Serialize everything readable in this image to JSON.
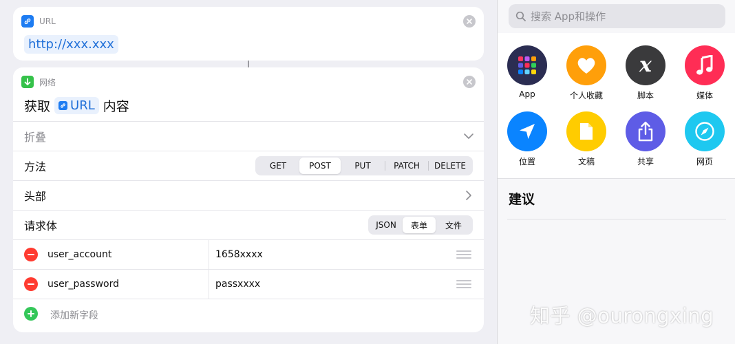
{
  "url_card": {
    "tag": "URL",
    "value": "http://xxx.xxx"
  },
  "net_card": {
    "tag": "网络",
    "title_prefix": "获取",
    "title_token": "URL",
    "title_suffix": "内容",
    "collapse_label": "折叠",
    "method_label": "方法",
    "methods": [
      "GET",
      "POST",
      "PUT",
      "PATCH",
      "DELETE"
    ],
    "method_selected": "POST",
    "headers_label": "头部",
    "body_label": "请求体",
    "body_types": [
      "JSON",
      "表单",
      "文件"
    ],
    "body_selected": "表单",
    "fields": [
      {
        "key": "user_account",
        "value": "1658xxxx"
      },
      {
        "key": "user_password",
        "value": "passxxxx"
      }
    ],
    "add_field_label": "添加新字段"
  },
  "panel": {
    "search_placeholder": "搜索 App和操作",
    "categories": [
      {
        "label": "App",
        "icon": "app-grid-icon",
        "color": "#2b2d52"
      },
      {
        "label": "个人收藏",
        "icon": "heart-icon",
        "color": "#ff9f0a"
      },
      {
        "label": "脚本",
        "icon": "script-x-icon",
        "color": "#3a3a3c"
      },
      {
        "label": "媒体",
        "icon": "music-note-icon",
        "color": "#ff2d55"
      },
      {
        "label": "位置",
        "icon": "location-arrow-icon",
        "color": "#0a84ff"
      },
      {
        "label": "文稿",
        "icon": "document-icon",
        "color": "#ffcc00"
      },
      {
        "label": "共享",
        "icon": "share-icon",
        "color": "#5e5ce6"
      },
      {
        "label": "网页",
        "icon": "compass-icon",
        "color": "#1ec8f0"
      }
    ],
    "suggestions_title": "建议"
  },
  "watermark": "知乎 @ourongxing"
}
